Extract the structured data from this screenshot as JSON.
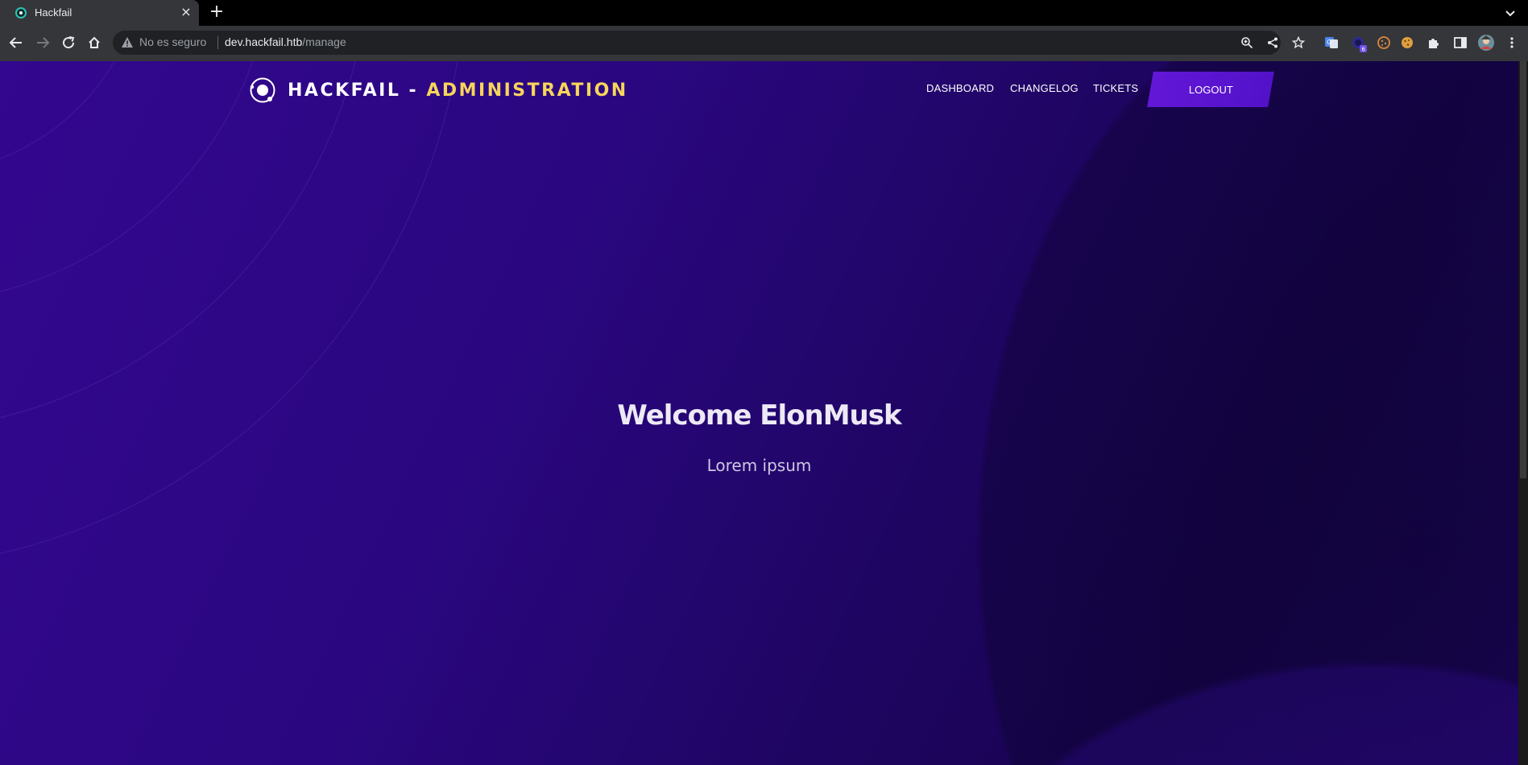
{
  "browser": {
    "tab_title": "Hackfail",
    "tab_close": "×",
    "new_tab": "+",
    "security_label": "No es seguro",
    "url_host": "dev.hackfail.htb",
    "url_path": "/manage",
    "icons": [
      "back-icon",
      "forward-icon",
      "reload-icon",
      "home-icon",
      "warning-icon",
      "zoom-icon",
      "share-icon",
      "bookmark-star-icon",
      "translate-extension-icon",
      "extension-badge-icon",
      "cookie-icon",
      "cookie-alt-icon",
      "puzzle-extensions-icon",
      "side-panel-icon",
      "profile-avatar-icon",
      "menu-kebab-icon"
    ],
    "extension_badge": "6"
  },
  "site": {
    "brand_main": "HACKFAIL - ",
    "brand_accent": "ADMINISTRATION",
    "nav": {
      "dashboard": "DASHBOARD",
      "changelog": "CHANGELOG",
      "tickets": "TICKETS",
      "logout": "LOGOUT"
    },
    "hero": {
      "title": "Welcome ElonMusk",
      "subtitle": "Lorem ipsum"
    },
    "colors": {
      "accent_yellow": "#f7d55a",
      "button_purple": "#5c14d2",
      "background_purple": "#26066f"
    }
  }
}
